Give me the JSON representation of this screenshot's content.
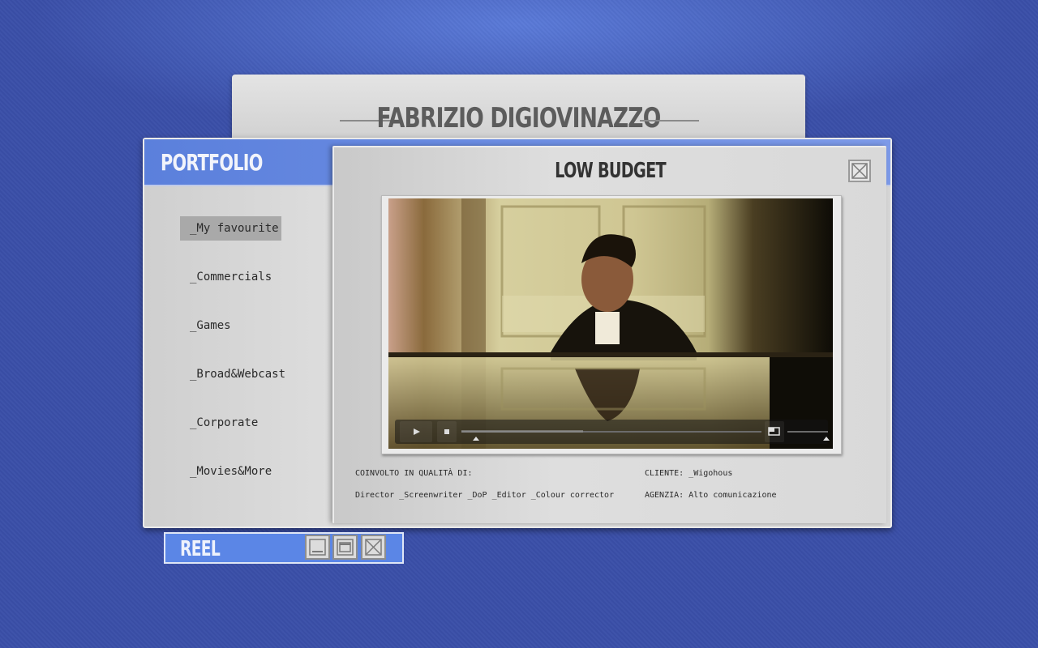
{
  "header": {
    "title": "FABRIZIO DIGIOVINAZZO"
  },
  "portfolio": {
    "title": "PORTFOLIO",
    "nav": [
      {
        "label": "_My favourite",
        "active": true
      },
      {
        "label": "_Commercials"
      },
      {
        "label": "_Games"
      },
      {
        "label": "_Broad&Webcast"
      },
      {
        "label": "_Corporate"
      },
      {
        "label": "_Movies&More"
      }
    ]
  },
  "project": {
    "title": "LOW BUDGET",
    "involved_label": "COINVOLTO IN QUALITÀ DI:",
    "roles": "Director _Screenwriter _DoP _Editor _Colour corrector",
    "client": "CLIENTE: _Wigohous",
    "agency": "AGENZIA: Alto comunicazione"
  },
  "player": {
    "icons": [
      "play-icon",
      "stop-icon",
      "fullscreen-icon"
    ],
    "progress": 0,
    "volume": 1
  },
  "reel": {
    "title": "REEL"
  },
  "colors": {
    "background": "#3a4fa8",
    "accent_bar": "#5b80dc",
    "panel": "#d6d6d6"
  }
}
